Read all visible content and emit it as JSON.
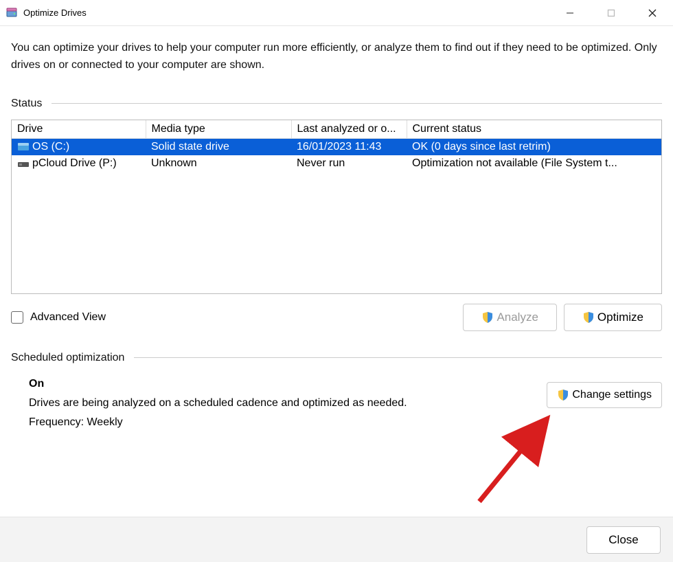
{
  "window": {
    "title": "Optimize Drives",
    "minimize_tip": "Minimize",
    "maximize_tip": "Maximize",
    "close_tip": "Close"
  },
  "intro": "You can optimize your drives to help your computer run more efficiently, or analyze them to find out if they need to be optimized. Only drives on or connected to your computer are shown.",
  "status_label": "Status",
  "columns": {
    "drive": "Drive",
    "media": "Media type",
    "last": "Last analyzed or o...",
    "status": "Current status"
  },
  "rows": [
    {
      "drive": "OS (C:)",
      "media": "Solid state drive",
      "last": "16/01/2023 11:43",
      "status": "OK (0 days since last retrim)",
      "selected": true,
      "iconcolor": "#2a8dd4"
    },
    {
      "drive": "pCloud Drive (P:)",
      "media": "Unknown",
      "last": "Never run",
      "status": "Optimization not available (File System t...",
      "selected": false,
      "iconcolor": "#444"
    }
  ],
  "advanced_view": "Advanced View",
  "analyze": "Analyze",
  "optimize": "Optimize",
  "scheduled_label": "Scheduled optimization",
  "schedule": {
    "state": "On",
    "desc": "Drives are being analyzed on a scheduled cadence and optimized as needed.",
    "freq": "Frequency: Weekly"
  },
  "change_settings": "Change settings",
  "close": "Close"
}
